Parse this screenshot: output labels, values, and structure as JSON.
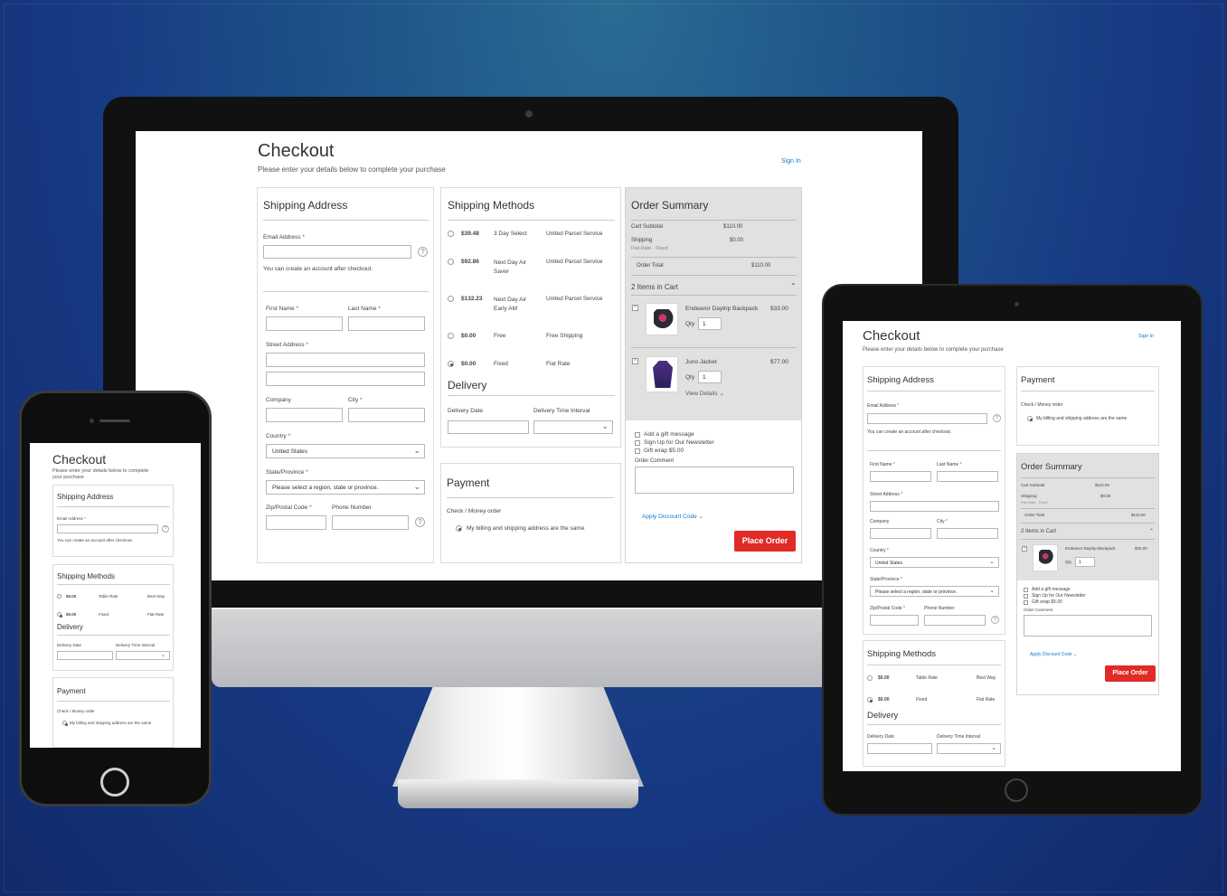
{
  "checkout": {
    "title": "Checkout",
    "subtitle": "Please enter your details below to complete your purchase",
    "subtitle_phone_1": "Please enter your details below to complete",
    "subtitle_phone_2": "your purchase",
    "sign_in": "Sign In"
  },
  "shipping_address": {
    "heading": "Shipping Address",
    "email_label": "Email Address",
    "account_note": "You can create an account after checkout.",
    "first_name_label": "First Name",
    "last_name_label": "Last Name",
    "street_label": "Street Address",
    "company_label": "Company",
    "city_label": "City",
    "country_label": "Country",
    "country_value": "United States",
    "state_label": "State/Province",
    "state_placeholder": "Please select a region, state or province.",
    "zip_label": "Zip/Postal Code",
    "phone_label": "Phone Number",
    "required_mark": "*",
    "help_glyph": "?"
  },
  "shipping_methods": {
    "heading": "Shipping Methods",
    "desktop_rows": [
      {
        "price": "$39.48",
        "method": "3 Day Select",
        "carrier": "United Parcel Service",
        "selected": false
      },
      {
        "price": "$92.86",
        "method": "Next Day Air Saver",
        "carrier": "United Parcel Service",
        "selected": false
      },
      {
        "price": "$132.23",
        "method": "Next Day Air Early AM",
        "carrier": "United Parcel Service",
        "selected": false
      },
      {
        "price": "$0.00",
        "method": "Free",
        "carrier": "Free Shipping",
        "selected": false
      },
      {
        "price": "$0.00",
        "method": "Fixed",
        "carrier": "Flat Rate",
        "selected": true
      }
    ],
    "mobile_rows": [
      {
        "price": "$0.00",
        "method": "Table Rate",
        "carrier": "Best Way",
        "selected": false
      },
      {
        "price": "$0.00",
        "method": "Fixed",
        "carrier": "Flat Rate",
        "selected": true
      }
    ]
  },
  "delivery": {
    "heading": "Delivery",
    "date_label": "Delivery Date",
    "interval_label": "Delivery Time Interval"
  },
  "payment": {
    "heading": "Payment",
    "method": "Check / Money order",
    "same_address": "My billing and shipping address are the same"
  },
  "order_summary": {
    "heading": "Order Summary",
    "cart_subtotal_label": "Cart Subtotal",
    "cart_subtotal": "$110.00",
    "shipping_label": "Shipping",
    "shipping_detail": "Flat Rate - Fixed",
    "shipping_value": "$0.00",
    "order_total_label": "Order Total",
    "order_total": "$110.00",
    "items_in_cart": "2 Items in Cart",
    "items": [
      {
        "name": "Endeavor Daytrip Backpack",
        "price": "$33.00",
        "qty": "1",
        "image": "backpack"
      },
      {
        "name": "Juno Jacket",
        "price": "$77.00",
        "qty": "1",
        "image": "jacket"
      }
    ],
    "qty_label": "Qty",
    "view_details": "View Details",
    "gift_message": "Add a gift message",
    "newsletter": "Sign Up for Our Newsletter",
    "gift_wrap": "Gift wrap $5.00",
    "order_comment": "Order Comment",
    "discount": "Apply Discount Code",
    "place_order": "Place Order"
  },
  "colors": {
    "accent_red": "#e02b27",
    "link_blue": "#1979c3",
    "background_top": "#2a6c93",
    "background_bottom": "#112a6b"
  },
  "icons": {
    "chevron_down": "⌄",
    "chevron_up": "⌃",
    "remove": "×"
  }
}
